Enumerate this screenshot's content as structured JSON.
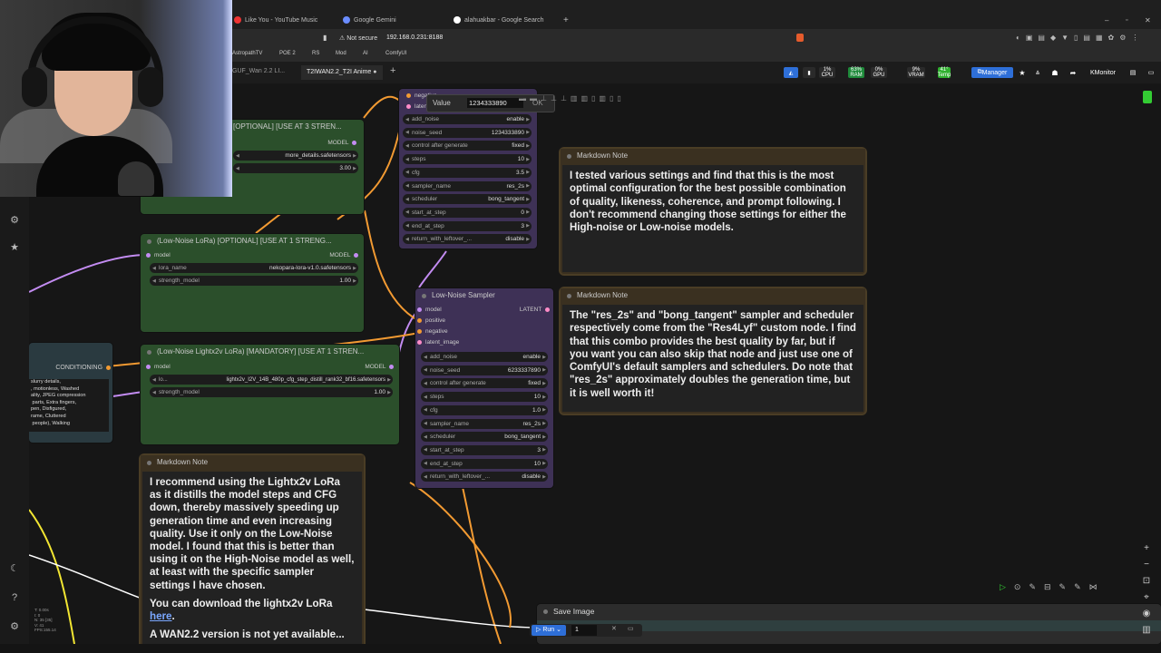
{
  "browser": {
    "tabs": [
      {
        "label": "Like You - YouTube Music"
      },
      {
        "label": "Google Gemini"
      },
      {
        "label": "alahuakbar - Google Search"
      }
    ],
    "address": {
      "security": "Not secure",
      "url": "192.168.0.231:8188"
    },
    "bookmarks": [
      "AstropathTV",
      "POE 2",
      "RS",
      "Mod",
      "AI",
      "ComfyUI"
    ]
  },
  "app": {
    "tabs": [
      {
        "label": "GUF_Wan 2.2 LI..."
      },
      {
        "label": "T2IWAN2.2_T2I Anime"
      }
    ],
    "monitor": {
      "cpu_pct": "1%",
      "cpu": "CPU",
      "ram_pct": "63%",
      "ram": "RAM",
      "gpu_pct": "0%",
      "gpu": "GPU",
      "vram_pct": "9%",
      "vram": "VRAM",
      "temp_val": "41°",
      "temp": "Temp"
    },
    "manager_label": "Manager",
    "monitor_label": "Monitor"
  },
  "nodes": {
    "top_lora": {
      "title": "[OPTIONAL] [USE AT 3 STREN...",
      "output": "MODEL",
      "lora_value": "more_details.safetensors",
      "strength_value": "3.00"
    },
    "high_sampler": {
      "inputs": [
        "negative",
        "latent"
      ],
      "widgets": [
        {
          "label": "add_noise",
          "value": "enable"
        },
        {
          "label": "noise_seed",
          "value": "1234333890"
        },
        {
          "label": "control after generate",
          "value": "fixed"
        },
        {
          "label": "steps",
          "value": "10"
        },
        {
          "label": "cfg",
          "value": "3.5"
        },
        {
          "label": "sampler_name",
          "value": "res_2s"
        },
        {
          "label": "scheduler",
          "value": "bong_tangent"
        },
        {
          "label": "start_at_step",
          "value": "0"
        },
        {
          "label": "end_at_step",
          "value": "3"
        },
        {
          "label": "return_with_leftover_...",
          "value": "disable"
        }
      ],
      "value_popup": {
        "label": "Value",
        "value": "1234333890",
        "ok": "OK"
      }
    },
    "low_lora": {
      "title": "(Low-Noise LoRa) [OPTIONAL] [USE AT 1 STRENG...",
      "input": "model",
      "output": "MODEL",
      "widgets": [
        {
          "label": "lora_name",
          "value": "nekopara-lora-v1.0.safetensors"
        },
        {
          "label": "strength_model",
          "value": "1.00"
        }
      ]
    },
    "low_sampler": {
      "title": "Low-Noise Sampler",
      "output": "LATENT",
      "inputs": [
        "model",
        "positive",
        "negative",
        "latent_image"
      ],
      "widgets": [
        {
          "label": "add_noise",
          "value": "enable"
        },
        {
          "label": "noise_seed",
          "value": "6233337890"
        },
        {
          "label": "control after generate",
          "value": "fixed"
        },
        {
          "label": "steps",
          "value": "10"
        },
        {
          "label": "cfg",
          "value": "1.0"
        },
        {
          "label": "sampler_name",
          "value": "res_2s"
        },
        {
          "label": "scheduler",
          "value": "bong_tangent"
        },
        {
          "label": "start_at_step",
          "value": "3"
        },
        {
          "label": "end_at_step",
          "value": "10"
        },
        {
          "label": "return_with_leftover_...",
          "value": "disable"
        }
      ]
    },
    "lightx_lora": {
      "title": "(Low-Noise Lightx2v LoRa) [MANDATORY] [USE AT 1 STREN...",
      "input": "model",
      "output": "MODEL",
      "widgets": [
        {
          "label": "lo...",
          "value": "lightx2v_I2V_14B_480p_cfg_step_distill_rank32_bf16.safetensors"
        },
        {
          "label": "strength_model",
          "value": "1.00"
        }
      ]
    },
    "conditioning": {
      "output": "CONDITIONING",
      "text": "slurry details,\n, motionless, Washed\nality, JPEG compression\n parts, Extra fingers,\npen, Disfigured,\nrame, Cluttered\n people), Walking"
    },
    "save_image": {
      "title": "Save Image"
    }
  },
  "notes": {
    "note1": {
      "title": "Markdown Note",
      "text": "I tested various settings and find that this is the most optimal configuration for the best possible combination of quality, likeness, coherence, and prompt following. I don't recommend changing those settings for either the High-noise or Low-noise models."
    },
    "note2": {
      "title": "Markdown Note",
      "text": "The \"res_2s\" and \"bong_tangent\" sampler and scheduler respectively come from the \"Res4Lyf\" custom node. I find that this combo provides the best quality by far, but if you want you can also skip that node and just use one of ComfyUI's default samplers and schedulers. Do note that \"res_2s\" approximately doubles the generation time, but it is well worth it!"
    },
    "note3": {
      "title": "Markdown Note",
      "para1": "I recommend using the Lightx2v LoRa as it distills the model steps and CFG down, thereby massively speeding up generation time and even increasing quality. Use it only on the Low-Noise model. I found that this is better than using it on the High-Noise model as well, at least with the specific sampler settings I have chosen.",
      "para2_prefix": "You can download the lightx2v LoRa",
      "para2_link": "here",
      "para2_suffix": ".",
      "para3": "A WAN2.2 version is not yet available..."
    }
  },
  "run": {
    "label": "Run",
    "count": "1"
  },
  "stats": [
    "T: 0.00s",
    "I: 0",
    "N: 35 [35]",
    "V: 41",
    "FPS:155.14"
  ]
}
